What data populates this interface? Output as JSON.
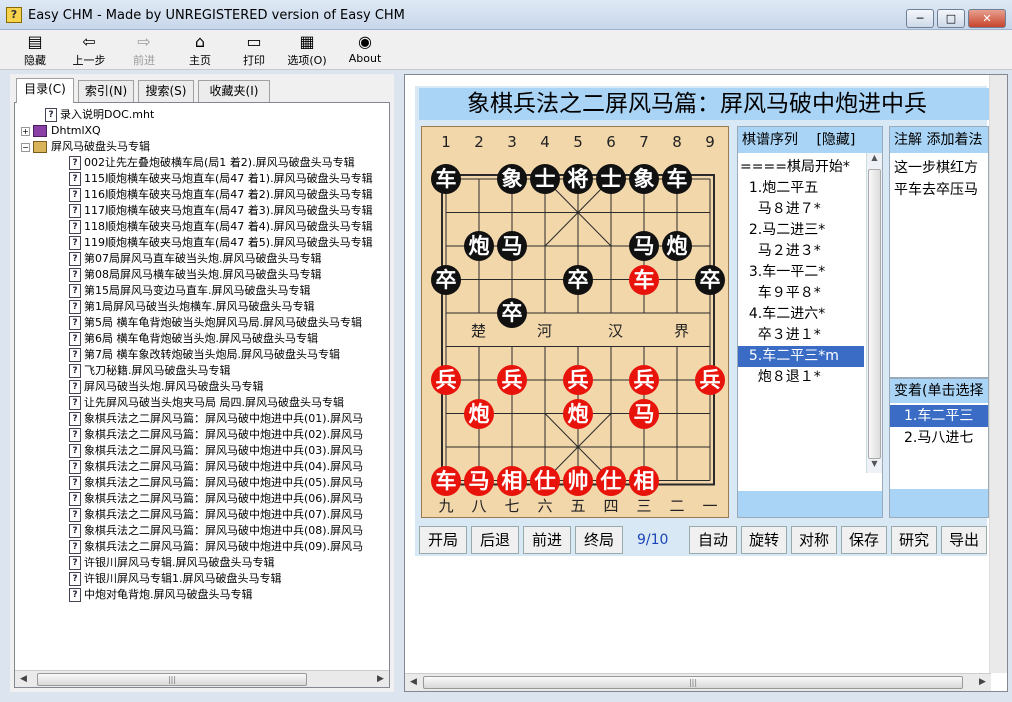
{
  "window": {
    "title": "Easy CHM - Made by UNREGISTERED version of Easy CHM",
    "app_icon": "help-question-icon",
    "minimize": "─",
    "maximize": "□",
    "close": "✕"
  },
  "toolbar": {
    "hide": "隐藏",
    "back": "上一步",
    "forward": "前进",
    "home": "主页",
    "print": "打印",
    "options": "选项(O)",
    "about": "About"
  },
  "nav_tabs": {
    "contents": "目录(C)",
    "index": "索引(N)",
    "search": "搜索(S)",
    "favorites": "收藏夹(I)"
  },
  "tree": {
    "items": [
      {
        "label": "录入说明DOC.mht",
        "type": "page",
        "level": 1
      },
      {
        "label": "DhtmlXQ",
        "type": "book",
        "level": 0,
        "expander": "+"
      },
      {
        "label": "屏风马破盘头马专辑",
        "type": "book-open",
        "level": 0,
        "expander": "−"
      },
      {
        "label": "002让先左叠炮破横车局(局1 着2).屏风马破盘头马专辑",
        "type": "page",
        "level": 2
      },
      {
        "label": "115顺炮横车破夹马炮直车(局47 着1).屏风马破盘头马专辑",
        "type": "page",
        "level": 2
      },
      {
        "label": "116顺炮横车破夹马炮直车(局47 着2).屏风马破盘头马专辑",
        "type": "page",
        "level": 2
      },
      {
        "label": "117顺炮横车破夹马炮直车(局47 着3).屏风马破盘头马专辑",
        "type": "page",
        "level": 2
      },
      {
        "label": "118顺炮横车破夹马炮直车(局47 着4).屏风马破盘头马专辑",
        "type": "page",
        "level": 2
      },
      {
        "label": "119顺炮横车破夹马炮直车(局47 着5).屏风马破盘头马专辑",
        "type": "page",
        "level": 2
      },
      {
        "label": "第07局屏风马直车破当头炮.屏风马破盘头马专辑",
        "type": "page",
        "level": 2
      },
      {
        "label": "第08局屏风马横车破当头炮.屏风马破盘头马专辑",
        "type": "page",
        "level": 2
      },
      {
        "label": "第15局屏风马变边马直车.屏风马破盘头马专辑",
        "type": "page",
        "level": 2
      },
      {
        "label": "第1局屏风马破当头炮横车.屏风马破盘头马专辑",
        "type": "page",
        "level": 2
      },
      {
        "label": "第5局 横车龟背炮破当头炮屏风马局.屏风马破盘头马专辑",
        "type": "page",
        "level": 2
      },
      {
        "label": "第6局 横车龟背炮破当头炮.屏风马破盘头马专辑",
        "type": "page",
        "level": 2
      },
      {
        "label": "第7局 横车象改转炮破当头炮局.屏风马破盘头马专辑",
        "type": "page",
        "level": 2
      },
      {
        "label": "飞刀秘籍.屏风马破盘头马专辑",
        "type": "page",
        "level": 2
      },
      {
        "label": "屏风马破当头炮.屏风马破盘头马专辑",
        "type": "page",
        "level": 2
      },
      {
        "label": "让先屏风马破当头炮夹马局 局四.屏风马破盘头马专辑",
        "type": "page",
        "level": 2
      },
      {
        "label": "象棋兵法之二屏风马篇：屏风马破中炮进中兵(01).屏风马",
        "type": "page",
        "level": 2
      },
      {
        "label": "象棋兵法之二屏风马篇：屏风马破中炮进中兵(02).屏风马",
        "type": "page",
        "level": 2
      },
      {
        "label": "象棋兵法之二屏风马篇：屏风马破中炮进中兵(03).屏风马",
        "type": "page",
        "level": 2
      },
      {
        "label": "象棋兵法之二屏风马篇：屏风马破中炮进中兵(04).屏风马",
        "type": "page",
        "level": 2
      },
      {
        "label": "象棋兵法之二屏风马篇：屏风马破中炮进中兵(05).屏风马",
        "type": "page",
        "level": 2
      },
      {
        "label": "象棋兵法之二屏风马篇：屏风马破中炮进中兵(06).屏风马",
        "type": "page",
        "level": 2
      },
      {
        "label": "象棋兵法之二屏风马篇：屏风马破中炮进中兵(07).屏风马",
        "type": "page",
        "level": 2
      },
      {
        "label": "象棋兵法之二屏风马篇：屏风马破中炮进中兵(08).屏风马",
        "type": "page",
        "level": 2
      },
      {
        "label": "象棋兵法之二屏风马篇：屏风马破中炮进中兵(09).屏风马",
        "type": "page",
        "level": 2
      },
      {
        "label": "许银川屏风马专辑.屏风马破盘头马专辑",
        "type": "page",
        "level": 2
      },
      {
        "label": "许银川屏风马专辑1.屏风马破盘头马专辑",
        "type": "page",
        "level": 2
      },
      {
        "label": "中炮对龟背炮.屏风马破盘头马专辑",
        "type": "page",
        "level": 2
      }
    ]
  },
  "game": {
    "title": "象棋兵法之二屏风马篇：屏风马破中炮进中兵",
    "file_numbers_top": [
      "1",
      "2",
      "3",
      "4",
      "5",
      "6",
      "7",
      "8",
      "9"
    ],
    "file_numbers_bottom": [
      "九",
      "八",
      "七",
      "六",
      "五",
      "四",
      "三",
      "二",
      "一"
    ],
    "river_left": "楚",
    "river_left2": "河",
    "river_right": "汉",
    "river_right2": "界",
    "pieces": [
      {
        "c": "车",
        "color": "black",
        "file": 0,
        "rank": 0
      },
      {
        "c": "象",
        "color": "black",
        "file": 2,
        "rank": 0
      },
      {
        "c": "士",
        "color": "black",
        "file": 3,
        "rank": 0
      },
      {
        "c": "将",
        "color": "black",
        "file": 4,
        "rank": 0
      },
      {
        "c": "士",
        "color": "black",
        "file": 5,
        "rank": 0
      },
      {
        "c": "象",
        "color": "black",
        "file": 6,
        "rank": 0
      },
      {
        "c": "车",
        "color": "black",
        "file": 7,
        "rank": 0
      },
      {
        "c": "炮",
        "color": "black",
        "file": 1,
        "rank": 2
      },
      {
        "c": "马",
        "color": "black",
        "file": 2,
        "rank": 2
      },
      {
        "c": "马",
        "color": "black",
        "file": 6,
        "rank": 2
      },
      {
        "c": "炮",
        "color": "black",
        "file": 7,
        "rank": 2
      },
      {
        "c": "卒",
        "color": "black",
        "file": 0,
        "rank": 3
      },
      {
        "c": "卒",
        "color": "black",
        "file": 4,
        "rank": 3
      },
      {
        "c": "卒",
        "color": "black",
        "file": 8,
        "rank": 3
      },
      {
        "c": "卒",
        "color": "black",
        "file": 2,
        "rank": 4
      },
      {
        "c": "车",
        "color": "red",
        "file": 6,
        "rank": 3
      },
      {
        "c": "兵",
        "color": "red",
        "file": 0,
        "rank": 6
      },
      {
        "c": "兵",
        "color": "red",
        "file": 2,
        "rank": 6
      },
      {
        "c": "兵",
        "color": "red",
        "file": 4,
        "rank": 6
      },
      {
        "c": "兵",
        "color": "red",
        "file": 6,
        "rank": 6
      },
      {
        "c": "兵",
        "color": "red",
        "file": 8,
        "rank": 6
      },
      {
        "c": "炮",
        "color": "red",
        "file": 1,
        "rank": 7
      },
      {
        "c": "炮",
        "color": "red",
        "file": 4,
        "rank": 7
      },
      {
        "c": "马",
        "color": "red",
        "file": 6,
        "rank": 7
      },
      {
        "c": "车",
        "color": "red",
        "file": 0,
        "rank": 9
      },
      {
        "c": "马",
        "color": "red",
        "file": 1,
        "rank": 9
      },
      {
        "c": "相",
        "color": "red",
        "file": 2,
        "rank": 9
      },
      {
        "c": "仕",
        "color": "red",
        "file": 3,
        "rank": 9
      },
      {
        "c": "帅",
        "color": "red",
        "file": 4,
        "rank": 9
      },
      {
        "c": "仕",
        "color": "red",
        "file": 5,
        "rank": 9
      },
      {
        "c": "相",
        "color": "red",
        "file": 6,
        "rank": 9
      }
    ]
  },
  "movelist": {
    "header": "棋谱序列",
    "hide": "[隐藏]",
    "moves": [
      "====棋局开始*",
      "  1.炮二平五",
      "    马８进７*",
      "  2.马二进三*",
      "    马２进３*",
      "  3.车一平二*",
      "    车９平８*",
      "  4.车二进六*",
      "    卒３进１*",
      "  5.车二平三*m",
      "    炮８退１*"
    ],
    "selected_index": 9
  },
  "note": {
    "header": "注解 添加着法",
    "line1": "这一步棋红方",
    "line2": "平车去卒压马"
  },
  "variations": {
    "header": "变着(单击选择",
    "items": [
      "1.车二平三",
      "2.马八进七"
    ],
    "selected_index": 0
  },
  "controls": {
    "start": "开局",
    "back": "后退",
    "forward": "前进",
    "end": "终局",
    "counter": "9/10",
    "auto": "自动",
    "rotate": "旋转",
    "mirror": "对称",
    "save": "保存",
    "analyze": "研究",
    "export": "导出"
  },
  "colors": {
    "accent": "#a9d4f5",
    "board": "#f2d7ab",
    "red_piece": "#e8140c",
    "black_piece": "#111111",
    "selection": "#3a6cc6"
  }
}
